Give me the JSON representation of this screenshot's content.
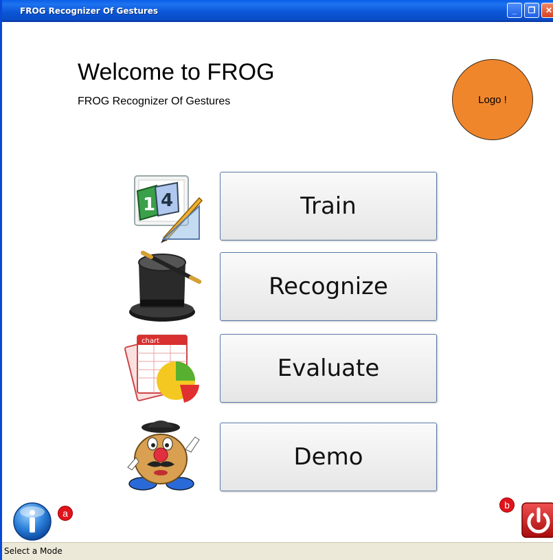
{
  "window": {
    "title": "FROG Recognizer Of Gestures",
    "minimize_label": "_",
    "maximize_label": "❐",
    "close_label": "✕"
  },
  "header": {
    "welcome": "Welcome to FROG",
    "subtitle": "FROG Recognizer Of Gestures",
    "logo_text": "Logo !"
  },
  "modes": [
    {
      "label": "Train",
      "icon": "ruler-pencil-icon"
    },
    {
      "label": "Recognize",
      "icon": "magic-hat-icon"
    },
    {
      "label": "Evaluate",
      "icon": "chart-icon"
    },
    {
      "label": "Demo",
      "icon": "potato-head-icon"
    }
  ],
  "annotations": {
    "a": "a",
    "b": "b"
  },
  "icons": {
    "info": "info-icon",
    "power": "power-icon"
  },
  "status": {
    "text": "Select a Mode"
  },
  "colors": {
    "titlebar": "#0a5fe8",
    "logo": "#f0862c",
    "badge": "#e0141c",
    "power": "#d42020",
    "info": "#2a7fd8"
  }
}
